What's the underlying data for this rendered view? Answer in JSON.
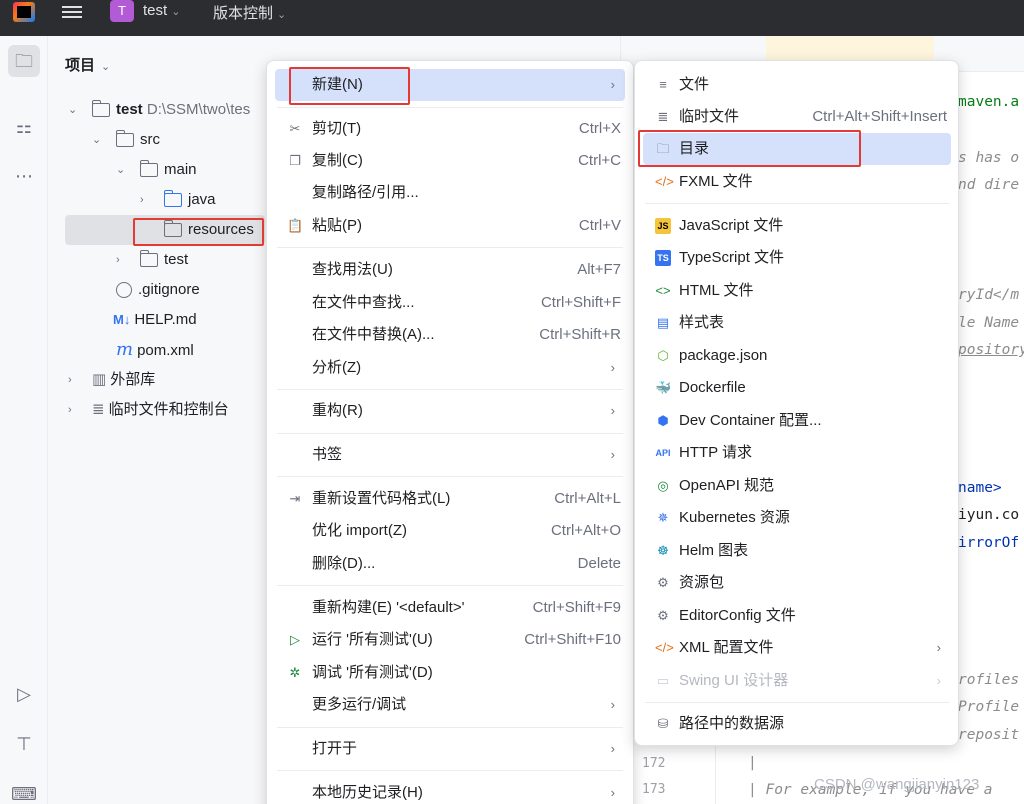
{
  "titlebar": {
    "project_badge": "T",
    "project_name": "test",
    "vcs_label": "版本控制"
  },
  "project_panel": {
    "header": "项目",
    "tree": [
      {
        "label": "test",
        "path": "D:\\SSM\\two\\tes"
      },
      {
        "label": "src"
      },
      {
        "label": "main"
      },
      {
        "label": "java"
      },
      {
        "label": "resources"
      },
      {
        "label": "test"
      },
      {
        "label": ".gitignore"
      },
      {
        "label": "HELP.md",
        "icon_text": "M↓"
      },
      {
        "label": "pom.xml",
        "icon_text": "m"
      },
      {
        "label": "外部库"
      },
      {
        "label": "临时文件和控制台"
      }
    ]
  },
  "editor": {
    "code_fragments": [
      "maven.a",
      "s has o",
      "nd dire",
      "ryId</m",
      "le Name",
      "pository",
      "name>",
      "iyun.co",
      "irrorOf",
      "rofiles",
      "Profile",
      "reposit"
    ],
    "line_numbers": [
      "172",
      "173"
    ],
    "bottom_lines": [
      "|",
      "| For example, if you have a"
    ]
  },
  "menu1": {
    "items": [
      {
        "label": "新建(N)",
        "icon": "",
        "shortcut": "",
        "submenu": true
      },
      {
        "label": "剪切(T)",
        "icon": "scissors-icon",
        "shortcut": "Ctrl+X"
      },
      {
        "label": "复制(C)",
        "icon": "copy-icon",
        "shortcut": "Ctrl+C"
      },
      {
        "label": "复制路径/引用...",
        "icon": "",
        "shortcut": ""
      },
      {
        "label": "粘贴(P)",
        "icon": "paste-icon",
        "shortcut": "Ctrl+V"
      },
      {
        "label": "查找用法(U)",
        "icon": "",
        "shortcut": "Alt+F7"
      },
      {
        "label": "在文件中查找...",
        "icon": "",
        "shortcut": "Ctrl+Shift+F"
      },
      {
        "label": "在文件中替换(A)...",
        "icon": "",
        "shortcut": "Ctrl+Shift+R"
      },
      {
        "label": "分析(Z)",
        "icon": "",
        "shortcut": "",
        "submenu": true
      },
      {
        "label": "重构(R)",
        "icon": "",
        "shortcut": "",
        "submenu": true
      },
      {
        "label": "书签",
        "icon": "",
        "shortcut": "",
        "submenu": true
      },
      {
        "label": "重新设置代码格式(L)",
        "icon": "format-icon",
        "shortcut": "Ctrl+Alt+L"
      },
      {
        "label": "优化 import(Z)",
        "icon": "",
        "shortcut": "Ctrl+Alt+O"
      },
      {
        "label": "删除(D)...",
        "icon": "",
        "shortcut": "Delete"
      },
      {
        "label": "重新构建(E) '<default>'",
        "icon": "",
        "shortcut": "Ctrl+Shift+F9"
      },
      {
        "label": "运行 '所有测试'(U)",
        "icon": "run-icon",
        "shortcut": "Ctrl+Shift+F10"
      },
      {
        "label": "调试 '所有测试'(D)",
        "icon": "debug-icon",
        "shortcut": ""
      },
      {
        "label": "更多运行/调试",
        "icon": "",
        "shortcut": "",
        "submenu": true
      },
      {
        "label": "打开于",
        "icon": "",
        "shortcut": "",
        "submenu": true
      },
      {
        "label": "本地历史记录(H)",
        "icon": "",
        "shortcut": "",
        "submenu": true
      }
    ]
  },
  "menu2": {
    "items": [
      {
        "label": "文件",
        "icon": "file-icon"
      },
      {
        "label": "临时文件",
        "icon": "scratch-file-icon",
        "shortcut": "Ctrl+Alt+Shift+Insert"
      },
      {
        "label": "目录",
        "icon": "folder-icon"
      },
      {
        "label": "FXML 文件",
        "icon": "fxml-icon"
      },
      {
        "label": "JavaScript 文件",
        "icon": "javascript-icon",
        "icon_text": "JS"
      },
      {
        "label": "TypeScript 文件",
        "icon": "typescript-icon",
        "icon_text": "TS"
      },
      {
        "label": "HTML 文件",
        "icon": "html-icon"
      },
      {
        "label": "样式表",
        "icon": "css-icon"
      },
      {
        "label": "package.json",
        "icon": "nodejs-icon"
      },
      {
        "label": "Dockerfile",
        "icon": "docker-icon"
      },
      {
        "label": "Dev Container 配置...",
        "icon": "dev-container-icon"
      },
      {
        "label": "HTTP 请求",
        "icon": "api-icon",
        "icon_text": "API"
      },
      {
        "label": "OpenAPI 规范",
        "icon": "openapi-icon"
      },
      {
        "label": "Kubernetes 资源",
        "icon": "kubernetes-icon"
      },
      {
        "label": "Helm 图表",
        "icon": "helm-icon"
      },
      {
        "label": "资源包",
        "icon": "resource-bundle-icon"
      },
      {
        "label": "EditorConfig 文件",
        "icon": "editorconfig-icon"
      },
      {
        "label": "XML 配置文件",
        "icon": "xml-icon",
        "submenu": true
      },
      {
        "label": "Swing UI 设计器",
        "icon": "swing-icon",
        "submenu": true,
        "disabled": true
      },
      {
        "label": "路径中的数据源",
        "icon": "database-icon"
      }
    ]
  },
  "watermark": "CSDN @wangjianyin123",
  "colors": {
    "highlight": "#d5e1fb",
    "annotation_red": "#e53935",
    "titlebar": "#2b2d30"
  }
}
